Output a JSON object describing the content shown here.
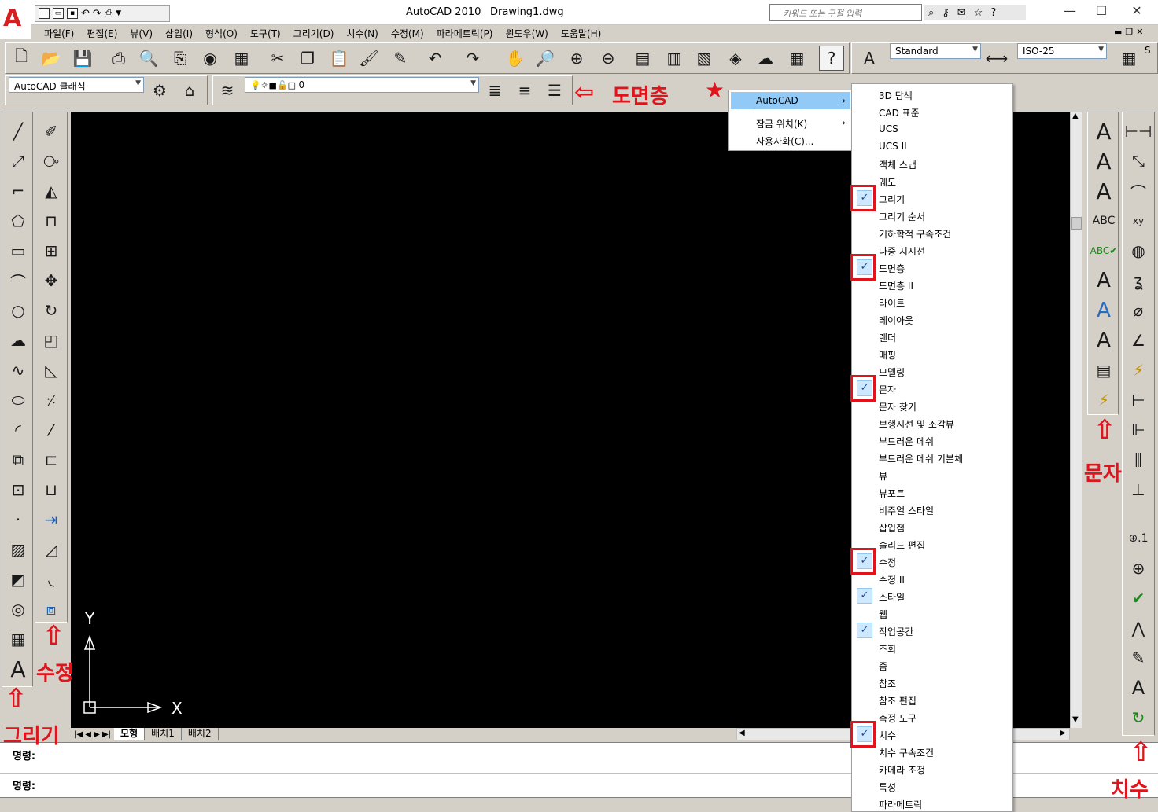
{
  "window": {
    "app_title": "AutoCAD 2010",
    "file_name": "Drawing1.dwg",
    "search_placeholder": "키워드 또는 구절 입력",
    "controls": [
      "—",
      "☐",
      "✕"
    ]
  },
  "menubar": [
    "파일(F)",
    "편집(E)",
    "뷰(V)",
    "삽입(I)",
    "형식(O)",
    "도구(T)",
    "그리기(D)",
    "치수(N)",
    "수정(M)",
    "파라메트릭(P)",
    "윈도우(W)",
    "도움말(H)"
  ],
  "style_toolbar": {
    "text_style": "Standard",
    "dim_style": "ISO-25",
    "extra": "S"
  },
  "workspace": {
    "current": "AutoCAD 클래식"
  },
  "layer": {
    "current": "0"
  },
  "layout_tabs": [
    "모형",
    "배치1",
    "배치2"
  ],
  "command_line": {
    "prompt1": "명령:",
    "prompt2": "명령:"
  },
  "ucs": {
    "y": "Y",
    "x": "X"
  },
  "context_menu": {
    "items": [
      {
        "label": "AutoCAD",
        "submenu": true,
        "highlighted": true
      },
      {
        "label": "잠금 위치(K)",
        "submenu": true
      },
      {
        "label": "사용자화(C)...",
        "submenu": false
      }
    ]
  },
  "toolbar_list": {
    "items": [
      {
        "label": "3D 탐색",
        "checked": false
      },
      {
        "label": "CAD 표준",
        "checked": false
      },
      {
        "label": "UCS",
        "checked": false
      },
      {
        "label": "UCS II",
        "checked": false
      },
      {
        "label": "객체 스냅",
        "checked": false
      },
      {
        "label": "궤도",
        "checked": false
      },
      {
        "label": "그리기",
        "checked": true,
        "boxed": true
      },
      {
        "label": "그리기 순서",
        "checked": false
      },
      {
        "label": "기하학적 구속조건",
        "checked": false
      },
      {
        "label": "다중 지시선",
        "checked": false
      },
      {
        "label": "도면층",
        "checked": true,
        "boxed": true
      },
      {
        "label": "도면층 II",
        "checked": false
      },
      {
        "label": "라이트",
        "checked": false
      },
      {
        "label": "레이아웃",
        "checked": false
      },
      {
        "label": "렌더",
        "checked": false
      },
      {
        "label": "매핑",
        "checked": false
      },
      {
        "label": "모델링",
        "checked": false
      },
      {
        "label": "문자",
        "checked": true,
        "boxed": true
      },
      {
        "label": "문자 찾기",
        "checked": false
      },
      {
        "label": "보행시선 및 조감뷰",
        "checked": false
      },
      {
        "label": "부드러운 메쉬",
        "checked": false
      },
      {
        "label": "부드러운 메쉬 기본체",
        "checked": false
      },
      {
        "label": "뷰",
        "checked": false
      },
      {
        "label": "뷰포트",
        "checked": false
      },
      {
        "label": "비주얼 스타일",
        "checked": false
      },
      {
        "label": "삽입점",
        "checked": false
      },
      {
        "label": "솔리드 편집",
        "checked": false
      },
      {
        "label": "수정",
        "checked": true,
        "boxed": true
      },
      {
        "label": "수정 II",
        "checked": false
      },
      {
        "label": "스타일",
        "checked": true,
        "boxed": false
      },
      {
        "label": "웹",
        "checked": false
      },
      {
        "label": "작업공간",
        "checked": true,
        "boxed": false
      },
      {
        "label": "조회",
        "checked": false
      },
      {
        "label": "줌",
        "checked": false
      },
      {
        "label": "참조",
        "checked": false
      },
      {
        "label": "참조 편집",
        "checked": false
      },
      {
        "label": "측정 도구",
        "checked": false
      },
      {
        "label": "치수",
        "checked": true,
        "boxed": true
      },
      {
        "label": "치수 구속조건",
        "checked": false
      },
      {
        "label": "카메라 조정",
        "checked": false
      },
      {
        "label": "특성",
        "checked": false
      },
      {
        "label": "파라메트릭",
        "checked": false
      }
    ]
  },
  "annotations": {
    "layer": "도면층",
    "star": "★",
    "text": "문자",
    "modify": "수정",
    "draw": "그리기",
    "dimension": "치수",
    "arrow_up": "⇧",
    "arrow_left": "⇦"
  },
  "colors": {
    "accent_red": "#e0141c",
    "highlight": "#91c9f7",
    "canvas": "#000000"
  }
}
